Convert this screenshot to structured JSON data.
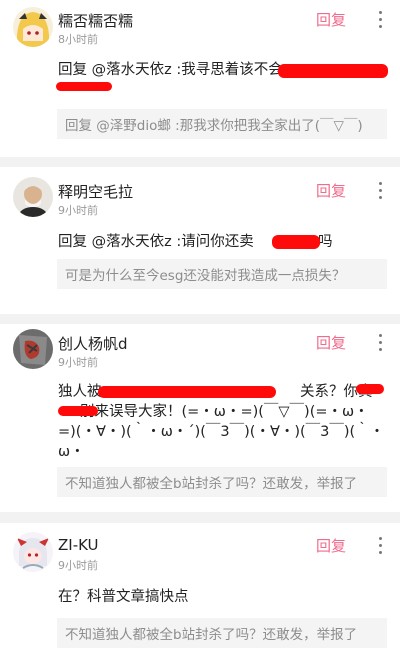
{
  "comments": [
    {
      "username": "糯否糯否糯",
      "time": "8小时前",
      "reply_label": "回复",
      "content_lines": [
        "回复 @落水天依z :我寻思着该不会"
      ],
      "sub_reply": "回复 @泽野dio螂 :那我求你把我全家出了(￣▽￣)"
    },
    {
      "username": "释明空毛拉",
      "time": "9小时前",
      "reply_label": "回复",
      "content_lines": [
        "回复 @落水天依z :请问你还卖",
        "吗"
      ],
      "sub_reply": "可是为什么至今esg还没能对我造成一点损失？"
    },
    {
      "username": "创人杨帆d",
      "time": "9小时前",
      "reply_label": "回复",
      "content_lines": [
        "独人被",
        "关系？你真",
        "别来误导大家！(=・ω・=)(￣▽￣)(=・ω・",
        "=)(・∀・)(｀・ω・´)(￣3￣)(・∀・)(￣3￣)(｀・",
        "ω・"
      ],
      "sub_reply": "不知道独人都被全b站封杀了吗？还敢发，举报了"
    },
    {
      "username": "ZI-KU",
      "time": "9小时前",
      "reply_label": "回复",
      "content_lines": [
        "在？科普文章搞快点"
      ],
      "sub_reply": "不知道独人都被全b站封杀了吗？还敢发，举报了"
    }
  ],
  "colors": {
    "accent": "#f06b8c",
    "redaction": "#ff0a0a",
    "separator": "#f2f2f2",
    "subreply_bg": "#f4f4f4"
  },
  "icons": [
    "more-vertical-icon"
  ]
}
